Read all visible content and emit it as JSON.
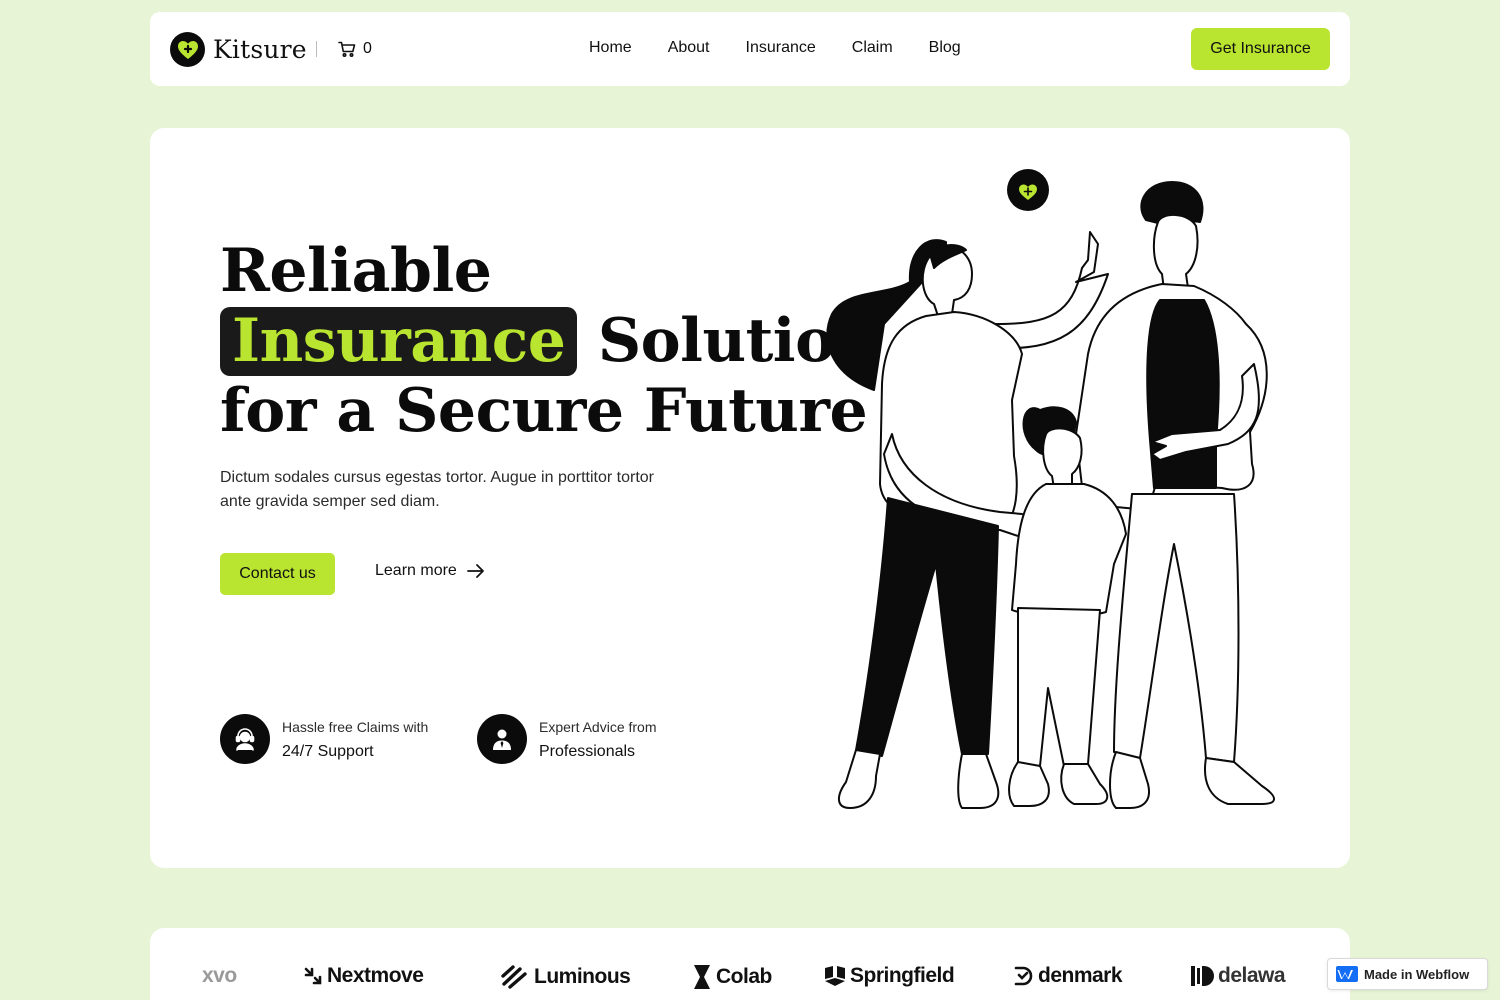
{
  "nav": {
    "brand": "Kitsure",
    "cart_count": "0",
    "links": [
      "Home",
      "About",
      "Insurance",
      "Claim",
      "Blog"
    ],
    "cta": "Get Insurance"
  },
  "hero": {
    "title_line1": "Reliable",
    "title_highlight": "Insurance",
    "title_line2_rest": "Solution",
    "title_line3": "for a Secure Future",
    "description": "Dictum sodales cursus egestas tortor. Augue in porttitor tortor ante gravida semper sed diam.",
    "primary_button": "Contact us",
    "secondary_button": "Learn more",
    "features": [
      {
        "small": "Hassle free Claims with",
        "big": "24/7 Support",
        "icon": "headset-icon"
      },
      {
        "small": "Expert Advice from",
        "big": "Professionals",
        "icon": "professional-icon"
      }
    ]
  },
  "logos": [
    "xvo",
    "Nextmove",
    "Luminous",
    "Colab",
    "Springfield",
    "denmark",
    "delawa"
  ],
  "badge": "Made in Webflow",
  "colors": {
    "accent": "#b9e42f",
    "background": "#e7f5d6",
    "dark": "#0b0b0b",
    "card": "#ffffff"
  }
}
